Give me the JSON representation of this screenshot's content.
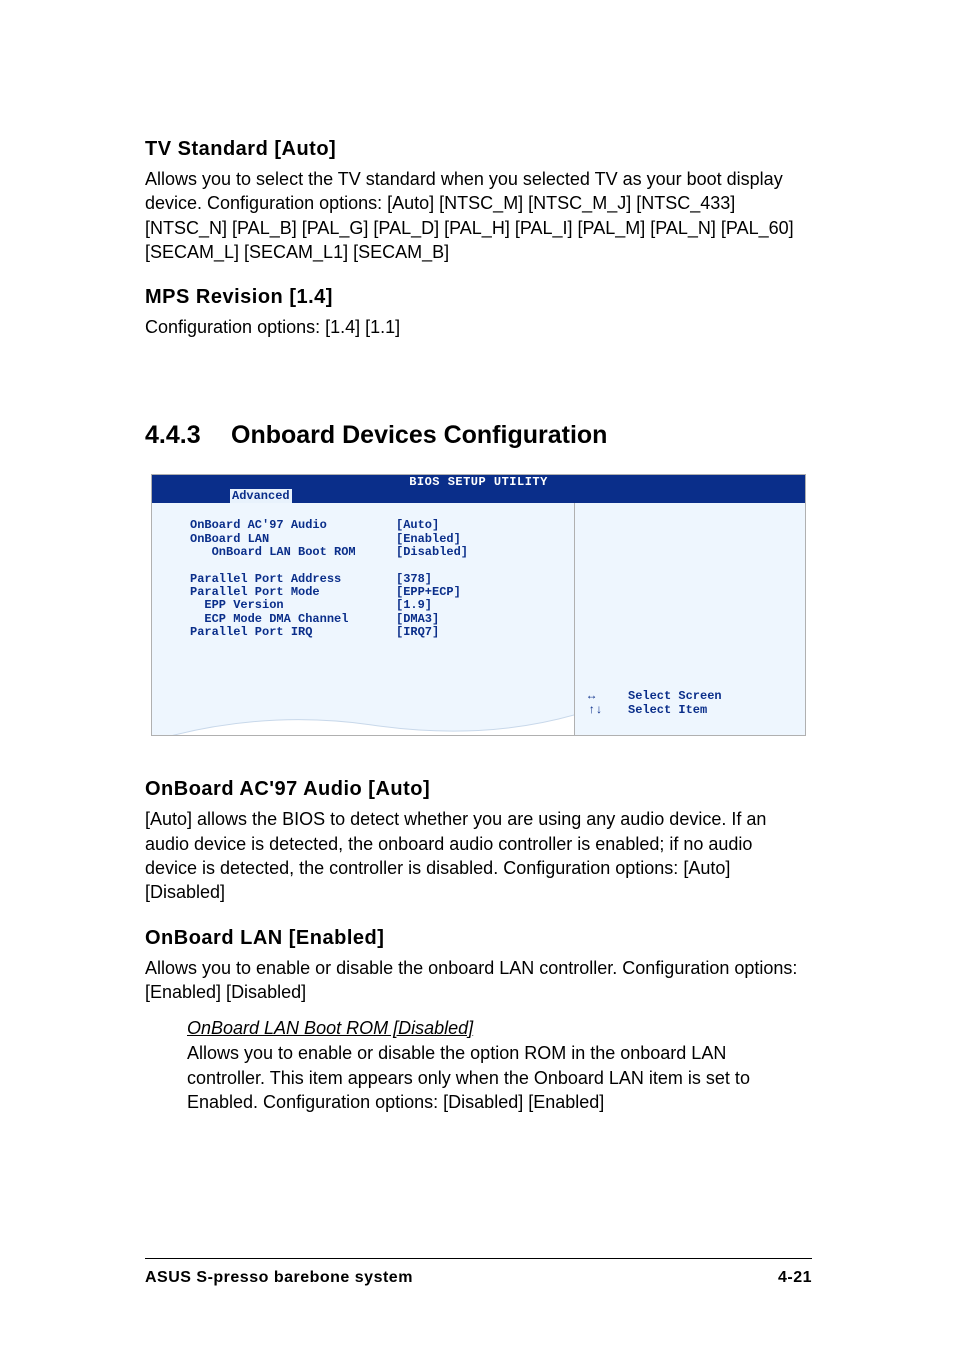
{
  "tv_standard": {
    "heading": "TV Standard [Auto]",
    "body": "Allows you to select the TV standard when you selected TV as your boot display device. Configuration options: [Auto] [NTSC_M] [NTSC_M_J] [NTSC_433] [NTSC_N] [PAL_B] [PAL_G] [PAL_D] [PAL_H] [PAL_I] [PAL_M] [PAL_N] [PAL_60] [SECAM_L] [SECAM_L1] [SECAM_B]"
  },
  "mps_revision": {
    "heading": "MPS Revision [1.4]",
    "body": "Configuration options: [1.4] [1.1]"
  },
  "section_heading": {
    "number": "4.4.3",
    "title": "Onboard Devices Configuration"
  },
  "bios": {
    "title": "BIOS SETUP UTILITY",
    "tab": "Advanced",
    "rows_group1": [
      {
        "label": "OnBoard AC'97 Audio",
        "value": "[Auto]"
      },
      {
        "label": "OnBoard LAN",
        "value": "[Enabled]"
      },
      {
        "label": "   OnBoard LAN Boot ROM",
        "value": "[Disabled]"
      }
    ],
    "rows_group2": [
      {
        "label": "Parallel Port Address",
        "value": "[378]"
      },
      {
        "label": "Parallel Port Mode",
        "value": "[EPP+ECP]"
      },
      {
        "label": "  EPP Version",
        "value": "[1.9]"
      },
      {
        "label": "  ECP Mode DMA Channel",
        "value": "[DMA3]"
      },
      {
        "label": "Parallel Port IRQ",
        "value": "[IRQ7]"
      }
    ],
    "help": [
      {
        "icon": "↔",
        "text": "Select Screen"
      },
      {
        "icon": "↑↓",
        "text": "Select Item"
      }
    ]
  },
  "ac97": {
    "heading": "OnBoard AC'97 Audio [Auto]",
    "body": "[Auto] allows the BIOS to detect whether you are using any audio device. If an audio device is detected, the onboard audio controller is enabled; if no audio device is detected, the controller is disabled. Configuration options: [Auto] [Disabled]"
  },
  "lan": {
    "heading": "OnBoard LAN [Enabled]",
    "body": "Allows you to enable or disable the onboard LAN controller. Configuration options: [Enabled] [Disabled]",
    "sub": {
      "title": "OnBoard LAN Boot ROM [Disabled]",
      "body": "Allows you to enable or disable the option ROM in the onboard LAN controller. This item appears only when the Onboard LAN item is set to Enabled. Configuration options: [Disabled] [Enabled]"
    }
  },
  "footer": {
    "left": "ASUS S-presso barebone system",
    "right": "4-21"
  }
}
